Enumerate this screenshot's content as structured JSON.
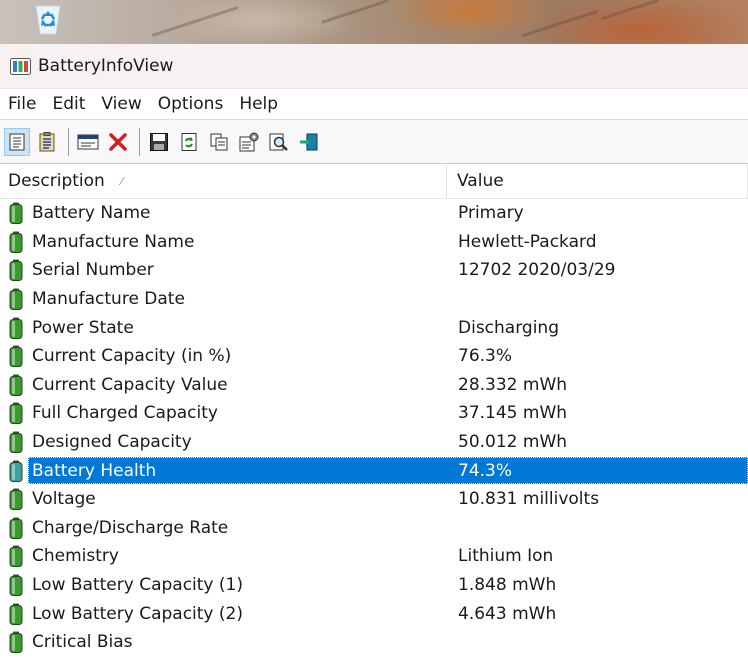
{
  "desktop": {
    "recycle_icon": "recycle-bin-icon"
  },
  "window": {
    "title": "BatteryInfoView"
  },
  "menu": [
    "File",
    "Edit",
    "View",
    "Options",
    "Help"
  ],
  "toolbar": [
    "html-report-icon",
    "properties-list-icon",
    "advanced-options-icon",
    "close-icon",
    "save-icon",
    "refresh-icon",
    "copy-icon",
    "properties-icon",
    "find-icon",
    "exit-icon"
  ],
  "columns": {
    "description": "Description",
    "value": "Value"
  },
  "rows": [
    {
      "description": "Battery Name",
      "value": "Primary"
    },
    {
      "description": "Manufacture Name",
      "value": "Hewlett-Packard"
    },
    {
      "description": "Serial Number",
      "value": "12702 2020/03/29"
    },
    {
      "description": "Manufacture Date",
      "value": ""
    },
    {
      "description": "Power State",
      "value": "Discharging"
    },
    {
      "description": "Current Capacity (in %)",
      "value": "76.3%"
    },
    {
      "description": "Current Capacity Value",
      "value": "28.332 mWh"
    },
    {
      "description": "Full Charged Capacity",
      "value": "37.145 mWh"
    },
    {
      "description": "Designed Capacity",
      "value": "50.012 mWh"
    },
    {
      "description": "Battery Health",
      "value": "74.3%",
      "selected": true
    },
    {
      "description": "Voltage",
      "value": "10.831 millivolts"
    },
    {
      "description": "Charge/Discharge Rate",
      "value": ""
    },
    {
      "description": "Chemistry",
      "value": "Lithium Ion"
    },
    {
      "description": "Low Battery Capacity (1)",
      "value": "1.848 mWh"
    },
    {
      "description": "Low Battery Capacity (2)",
      "value": "4.643 mWh"
    },
    {
      "description": "Critical Bias",
      "value": ""
    }
  ],
  "colors": {
    "selection": "#0078d7",
    "battery_green": "#3a9a2e"
  }
}
